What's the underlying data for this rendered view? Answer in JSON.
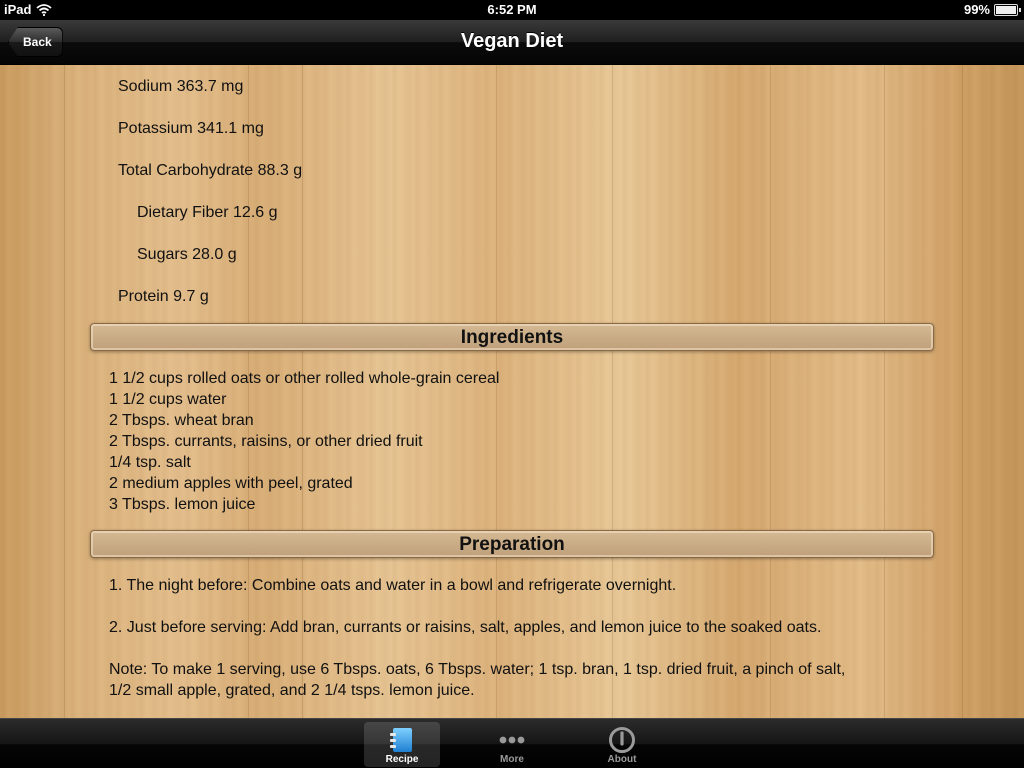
{
  "status_bar": {
    "device": "iPad",
    "time": "6:52 PM",
    "battery": "99%",
    "battery_level": 0.99
  },
  "nav": {
    "back_label": "Back",
    "title": "Vegan Diet"
  },
  "nutrition": [
    {
      "label": "Sodium 363.7 mg",
      "indent": false
    },
    {
      "label": "Potassium 341.1 mg",
      "indent": false
    },
    {
      "label": "Total Carbohydrate 88.3 g",
      "indent": false
    },
    {
      "label": "Dietary Fiber 12.6 g",
      "indent": true
    },
    {
      "label": "Sugars 28.0 g",
      "indent": true
    },
    {
      "label": "Protein 9.7 g",
      "indent": false
    }
  ],
  "ingredients": {
    "heading": "Ingredients",
    "items": [
      "1 1/2 cups rolled oats or other rolled whole-grain cereal",
      "1 1/2 cups water",
      "2 Tbsps. wheat bran",
      "2 Tbsps. currants, raisins, or other dried fruit",
      "1/4 tsp. salt",
      "2 medium apples with peel, grated",
      "3 Tbsps. lemon juice"
    ]
  },
  "preparation": {
    "heading": "Preparation",
    "steps": [
      "1. The night before: Combine oats and water in a bowl and refrigerate overnight.",
      "2. Just before serving: Add bran, currants or raisins, salt, apples, and lemon juice to the soaked oats.",
      "Note: To make 1 serving, use 6 Tbsps. oats, 6 Tbsps. water; 1 tsp. bran, 1 tsp. dried fruit, a pinch of salt, 1/2 small apple, grated, and 2 1/4 tsps. lemon juice."
    ]
  },
  "tab_bar": {
    "tabs": [
      {
        "label": "Recipe",
        "icon": "recipe-icon",
        "selected": true
      },
      {
        "label": "More",
        "icon": "more-icon",
        "selected": false
      },
      {
        "label": "About",
        "icon": "power-icon",
        "selected": false
      }
    ]
  }
}
